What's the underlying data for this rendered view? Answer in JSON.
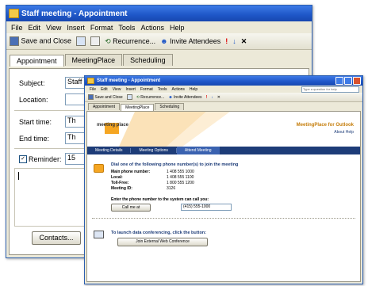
{
  "back": {
    "title": "Staff meeting - Appointment",
    "menu": [
      "File",
      "Edit",
      "View",
      "Insert",
      "Format",
      "Tools",
      "Actions",
      "Help"
    ],
    "toolbar": {
      "save_close": "Save and Close",
      "recurrence": "Recurrence...",
      "invite": "Invite Attendees",
      "importance_high": "!",
      "importance_low": "↓",
      "delete": "✕"
    },
    "tabs": [
      "Appointment",
      "MeetingPlace",
      "Scheduling"
    ],
    "subject_label": "Subject:",
    "subject_value": "Staff m",
    "location_label": "Location:",
    "start_label": "Start time:",
    "start_value": "Th",
    "end_label": "End time:",
    "end_value": "Th",
    "reminder_label": "Reminder:",
    "reminder_value": "15",
    "contacts_button": "Contacts..."
  },
  "front": {
    "title": "Staff meeting - Appointment",
    "menu": [
      "File",
      "Edit",
      "View",
      "Insert",
      "Format",
      "Tools",
      "Actions",
      "Help"
    ],
    "help_placeholder": "Type a question for help",
    "toolbar": {
      "save_close": "Save and Close",
      "recurrence": "Recurrence...",
      "invite": "Invite Attendees"
    },
    "tabs": [
      "Appointment",
      "MeetingPlace",
      "Scheduling"
    ],
    "brand_logo": "meeting place",
    "brand_title": "MeetingPlace for Outlook",
    "brand_links": "About  Help",
    "nav": [
      "Meeting Details",
      "Meeting Options",
      "Attend Meeting"
    ],
    "dial_heading": "Dial one of the following phone number(s) to join the meeting",
    "phone_rows": [
      {
        "label": "Main phone number:",
        "value": "1 408 555 1000"
      },
      {
        "label": "Local:",
        "value": "1 408 555 1100"
      },
      {
        "label": "Toll-Free:",
        "value": "1 800 555 1200"
      },
      {
        "label": "Meeting ID:",
        "value": "3126"
      }
    ],
    "callback_heading": "Enter the phone number to the system can call you:",
    "call_me_button": "Call me at",
    "callback_value": "(415) 555-1000",
    "data_conf_heading": "To launch data conferencing, click the button:",
    "join_web_button": "Join External Web Conference"
  },
  "colors": {
    "titlebar": "#1e56c7",
    "nav_bar": "#1d3c78",
    "brand_orange": "#f5a623"
  }
}
